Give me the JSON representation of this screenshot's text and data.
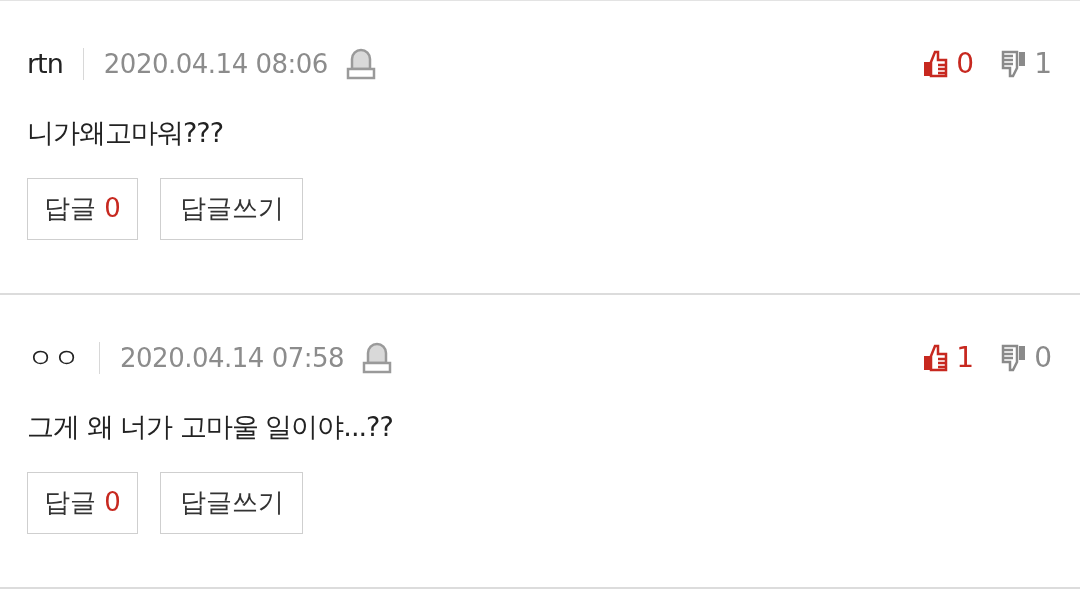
{
  "comments": [
    {
      "author": "rtn",
      "time": "2020.04.14 08:06",
      "likes": "0",
      "dislikes": "1",
      "body": "니가왜고마워???",
      "reply_label": "답글",
      "reply_count": "0",
      "write_label": "답글쓰기"
    },
    {
      "author": "ㅇㅇ",
      "time": "2020.04.14 07:58",
      "likes": "1",
      "dislikes": "0",
      "body": "그게 왜 너가 고마울 일이야...??",
      "reply_label": "답글",
      "reply_count": "0",
      "write_label": "답글쓰기"
    }
  ]
}
